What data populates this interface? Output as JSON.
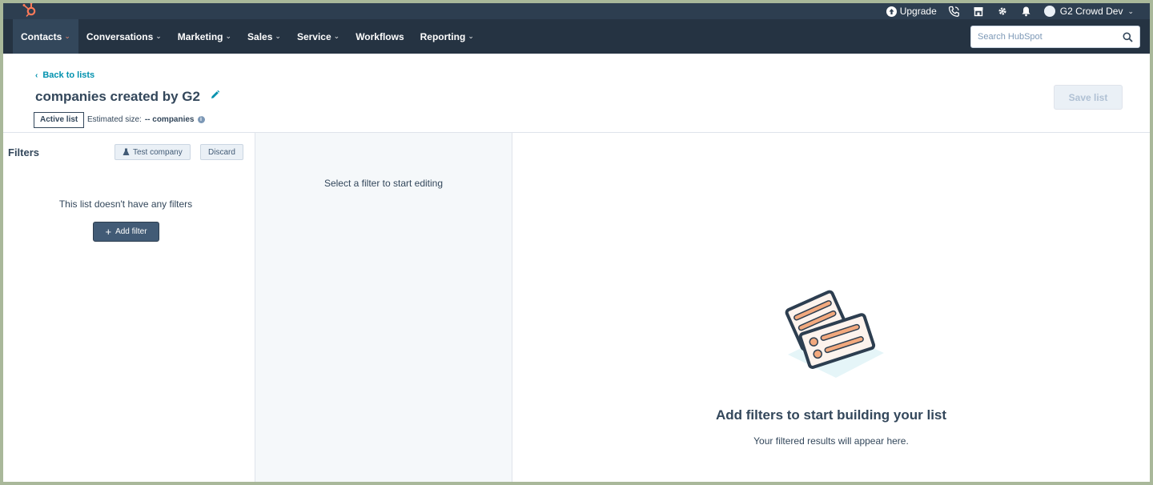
{
  "utility": {
    "upgrade_label": "Upgrade",
    "account_name": "G2 Crowd Dev"
  },
  "nav": {
    "items": [
      {
        "label": "Contacts",
        "has_menu": true,
        "active": true
      },
      {
        "label": "Conversations",
        "has_menu": true
      },
      {
        "label": "Marketing",
        "has_menu": true
      },
      {
        "label": "Sales",
        "has_menu": true
      },
      {
        "label": "Service",
        "has_menu": true
      },
      {
        "label": "Workflows",
        "has_menu": false
      },
      {
        "label": "Reporting",
        "has_menu": true
      }
    ],
    "search_placeholder": "Search HubSpot"
  },
  "header": {
    "back_label": "Back to lists",
    "title": "companies created by G2",
    "list_type": "Active list",
    "estimated_label": "Estimated size:",
    "estimated_value": "-- companies",
    "save_label": "Save list"
  },
  "filters": {
    "title": "Filters",
    "test_label": "Test company",
    "discard_label": "Discard",
    "empty_text": "This list doesn't have any filters",
    "add_label": "Add filter"
  },
  "editor": {
    "message": "Select a filter to start editing"
  },
  "results": {
    "title": "Add filters to start building your list",
    "subtitle": "Your filtered results will appear here."
  },
  "colors": {
    "nav_bg": "#253342",
    "utility_bg": "#2d3e50",
    "accent": "#ff7a59",
    "link": "#0091ae",
    "text": "#33475b"
  }
}
